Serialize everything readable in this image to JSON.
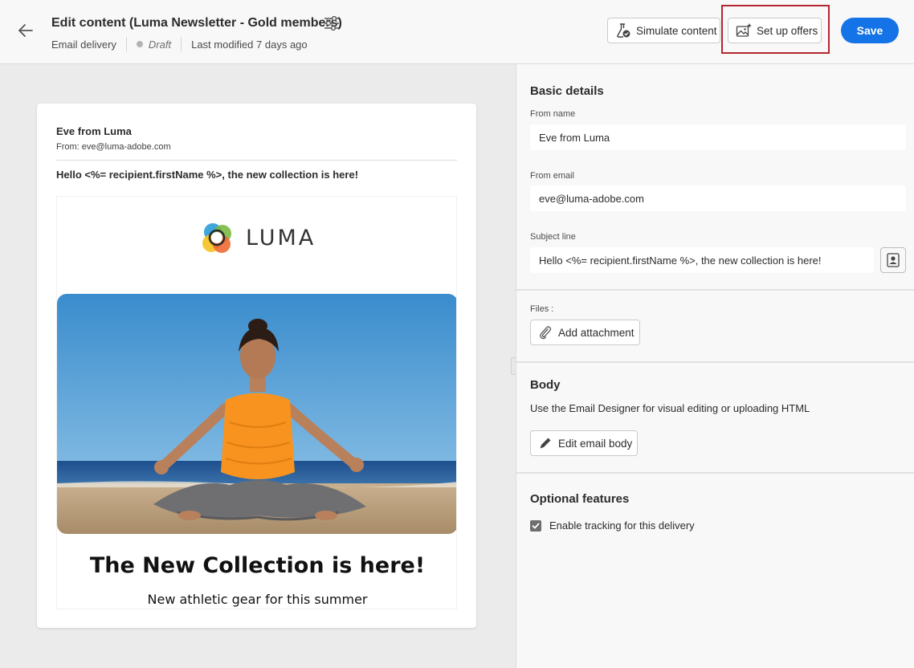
{
  "header": {
    "title": "Edit content (Luma Newsletter - Gold members)",
    "channel": "Email delivery",
    "status": "Draft",
    "last_modified": "Last modified 7 days ago",
    "simulate_label": "Simulate content",
    "offers_label": "Set up offers",
    "save_label": "Save",
    "accent_color": "#1473e6",
    "highlight_color": "#b3262d"
  },
  "preview": {
    "sender_name": "Eve from Luma",
    "sender_email": "From: eve@luma-adobe.com",
    "subject": "Hello <%= recipient.firstName %>, the new collection is here!",
    "logo_text": "LUMA",
    "headline": "The New Collection is here!",
    "subheadline": "New athletic gear for this summer"
  },
  "panel": {
    "basic_details": {
      "title": "Basic details",
      "from_name_label": "From name",
      "from_name_value": "Eve from Luma",
      "from_email_label": "From email",
      "from_email_value": "eve@luma-adobe.com",
      "subject_label": "Subject line",
      "subject_value": "Hello <%= recipient.firstName %>, the new collection is here!"
    },
    "files": {
      "label": "Files :",
      "add_attachment_label": "Add attachment"
    },
    "body": {
      "title": "Body",
      "description": "Use the Email Designer for visual editing or uploading HTML",
      "edit_label": "Edit email body"
    },
    "optional": {
      "title": "Optional features",
      "tracking_label": "Enable tracking for this delivery",
      "tracking_checked": true
    }
  }
}
